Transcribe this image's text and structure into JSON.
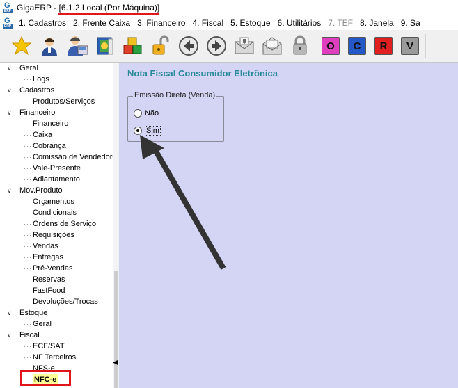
{
  "window": {
    "app_name": "GigaERP",
    "title_sep": " - ",
    "title_version": "[6.1.2  Local (Por Máquina)]",
    "logo_letter": "G",
    "logo_sub": "ERP"
  },
  "menu": {
    "items": [
      {
        "label": "1.  Cadastros",
        "enabled": true
      },
      {
        "label": "2.  Frente Caixa",
        "enabled": true
      },
      {
        "label": "3.  Financeiro",
        "enabled": true
      },
      {
        "label": "4.  Fiscal",
        "enabled": true
      },
      {
        "label": "5.  Estoque",
        "enabled": true
      },
      {
        "label": "6.  Utilitários",
        "enabled": true
      },
      {
        "label": "7.  TEF",
        "enabled": false
      },
      {
        "label": "8.  Janela",
        "enabled": true
      },
      {
        "label": "9.  Sa",
        "enabled": true
      }
    ]
  },
  "toolbar": {
    "buttons": [
      {
        "icon": "star-icon"
      },
      {
        "icon": "user-icon"
      },
      {
        "icon": "cashier-icon"
      },
      {
        "icon": "book-icon"
      },
      {
        "icon": "boxes-icon"
      },
      {
        "icon": "unlock-icon"
      },
      {
        "icon": "back-arrow-icon"
      },
      {
        "icon": "forward-arrow-icon"
      },
      {
        "icon": "mail-receive-icon"
      },
      {
        "icon": "mail-open-icon"
      },
      {
        "icon": "lock-icon"
      }
    ],
    "letter_buttons": [
      {
        "letter": "O",
        "color": "#e040c0"
      },
      {
        "letter": "C",
        "color": "#2457c8"
      },
      {
        "letter": "R",
        "color": "#e02020"
      },
      {
        "letter": "V",
        "color": "#9a9a9a"
      }
    ]
  },
  "tree": {
    "nodes": [
      {
        "level": 0,
        "label": "Geral"
      },
      {
        "level": 1,
        "label": "Logs"
      },
      {
        "level": 0,
        "label": "Cadastros"
      },
      {
        "level": 1,
        "label": "Produtos/Serviços"
      },
      {
        "level": 0,
        "label": "Financeiro"
      },
      {
        "level": 1,
        "label": "Financeiro"
      },
      {
        "level": 1,
        "label": "Caixa"
      },
      {
        "level": 1,
        "label": "Cobrança"
      },
      {
        "level": 1,
        "label": "Comissão de Vendedores"
      },
      {
        "level": 1,
        "label": "Vale-Presente"
      },
      {
        "level": 1,
        "label": "Adiantamento"
      },
      {
        "level": 0,
        "label": "Mov.Produto"
      },
      {
        "level": 1,
        "label": "Orçamentos"
      },
      {
        "level": 1,
        "label": "Condicionais"
      },
      {
        "level": 1,
        "label": "Ordens de Serviço"
      },
      {
        "level": 1,
        "label": "Requisições"
      },
      {
        "level": 1,
        "label": "Vendas"
      },
      {
        "level": 1,
        "label": "Entregas"
      },
      {
        "level": 1,
        "label": "Pré-Vendas"
      },
      {
        "level": 1,
        "label": "Reservas"
      },
      {
        "level": 1,
        "label": "FastFood"
      },
      {
        "level": 1,
        "label": "Devoluções/Trocas"
      },
      {
        "level": 0,
        "label": "Estoque"
      },
      {
        "level": 1,
        "label": "Geral"
      },
      {
        "level": 0,
        "label": "Fiscal"
      },
      {
        "level": 1,
        "label": "ECF/SAT"
      },
      {
        "level": 1,
        "label": "NF Terceiros"
      },
      {
        "level": 1,
        "label": "NFS-e"
      },
      {
        "level": 1,
        "label": "NFC-e",
        "selected": true
      }
    ]
  },
  "content": {
    "title": "Nota Fiscal Consumidor Eletrônica",
    "group_title": "Emissão Direta (Venda)",
    "option_no": "Não",
    "option_yes": "Sim",
    "selected_option": "Sim"
  },
  "colors": {
    "annotation_red": "#e0161b",
    "content_bg": "#d4d4f4",
    "title_teal": "#2a8a9a"
  }
}
